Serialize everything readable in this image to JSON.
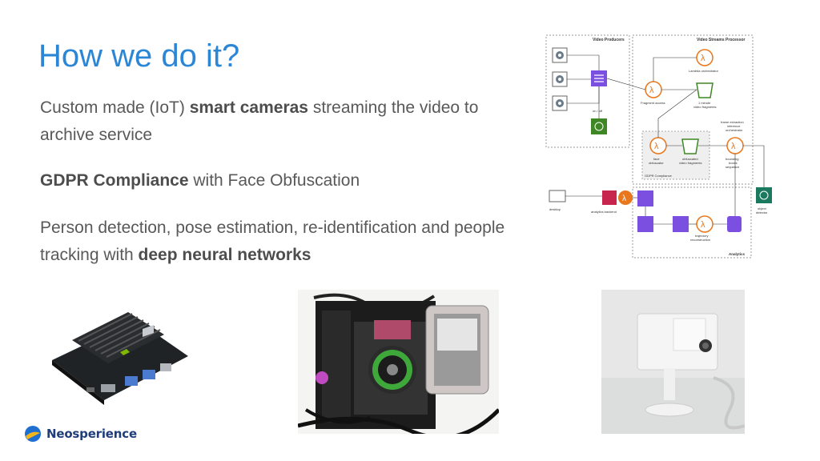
{
  "slide": {
    "title": "How we do it?",
    "para1": {
      "pre": "Custom made (IoT) ",
      "bold": "smart cameras",
      "post": " streaming the video to archive service"
    },
    "para2": {
      "bold": "GDPR Compliance",
      "post": " with Face Obfuscation"
    },
    "para3": {
      "pre": "Person detection, pose estimation, re-identification and people tracking with ",
      "bold": "deep neural networks"
    }
  },
  "diagram": {
    "sections": {
      "producers": "Video Producers",
      "processor": "Video Streams Processor",
      "gdpr": "GDPR Compliance",
      "analytics": "Analytics"
    },
    "labels": {
      "lambda_orchestrator": "Lambda orchestrator",
      "fragment_access": "Fragment access",
      "one_minute": "1 minute",
      "video_fragments": "video fragments",
      "on_off": "on / off",
      "frame_extraction": "frame extraction",
      "inference": "inference",
      "orchestrator": "orchestrator",
      "face": "face",
      "obfuscator": "obfuscator",
      "obfuscated": "obfuscated",
      "video_fragments2": "video fragments",
      "bounding": "bounding",
      "boxes": "boxes",
      "sequence": "sequence",
      "desktop": "desktop",
      "analytics_backend": "analytics backend",
      "trajectory": "trajectory",
      "reconstruction": "reconstruction",
      "object": "object",
      "detector": "detector"
    },
    "colors": {
      "lambda": "#e8771d",
      "bucket": "#3f8624",
      "stream": "#7b4fe0",
      "analytics": "#c7254e",
      "ml": "#1b7a5e"
    }
  },
  "photos": {
    "jetson": "nvidia-jetson-board",
    "rig": "gpu-server-rig",
    "camera": "smart-camera-device"
  },
  "logo": {
    "text": "Neosperience"
  }
}
